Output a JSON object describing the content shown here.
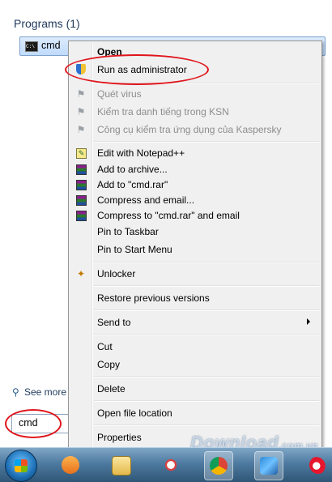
{
  "start_menu": {
    "section_title": "Programs (1)",
    "program": {
      "label": "cmd",
      "icon": "cmd-icon"
    },
    "see_more": "See more",
    "search_value": "cmd"
  },
  "context_menu": {
    "items": [
      {
        "label": "Open",
        "bold": true
      },
      {
        "label": "Run as administrator",
        "icon": "uac-shield-icon"
      },
      {
        "label": "Quét virus",
        "disabled": true,
        "icon": "kaspersky-icon"
      },
      {
        "label": "Kiểm tra danh tiếng trong KSN",
        "disabled": true,
        "icon": "kaspersky-icon"
      },
      {
        "label": "Công cụ kiểm tra ứng dụng của Kaspersky",
        "disabled": true,
        "icon": "kaspersky-icon"
      },
      {
        "label": "Edit with Notepad++",
        "icon": "notepadpp-icon"
      },
      {
        "label": "Add to archive...",
        "icon": "winrar-icon"
      },
      {
        "label": "Add to \"cmd.rar\"",
        "icon": "winrar-icon"
      },
      {
        "label": "Compress and email...",
        "icon": "winrar-icon"
      },
      {
        "label": "Compress to \"cmd.rar\" and email",
        "icon": "winrar-icon"
      },
      {
        "label": "Pin to Taskbar"
      },
      {
        "label": "Pin to Start Menu"
      },
      {
        "label": "Unlocker",
        "icon": "unlocker-wand-icon"
      },
      {
        "label": "Restore previous versions"
      },
      {
        "label": "Send to",
        "submenu": true
      },
      {
        "label": "Cut"
      },
      {
        "label": "Copy"
      },
      {
        "label": "Delete"
      },
      {
        "label": "Open file location"
      },
      {
        "label": "Properties"
      }
    ]
  },
  "taskbar": {
    "items": [
      {
        "name": "media-player-icon"
      },
      {
        "name": "explorer-icon"
      },
      {
        "name": "snipping-tool-icon"
      },
      {
        "name": "chrome-icon",
        "active": true
      },
      {
        "name": "feather-app-icon",
        "active": true
      },
      {
        "name": "weibo-icon"
      }
    ]
  },
  "watermark": {
    "main": "Download",
    "suffix": ".com.vn"
  },
  "colors": {
    "highlight_red": "#e0141b",
    "menu_bg": "#f0f0f0",
    "title_blue": "#1e395b"
  }
}
